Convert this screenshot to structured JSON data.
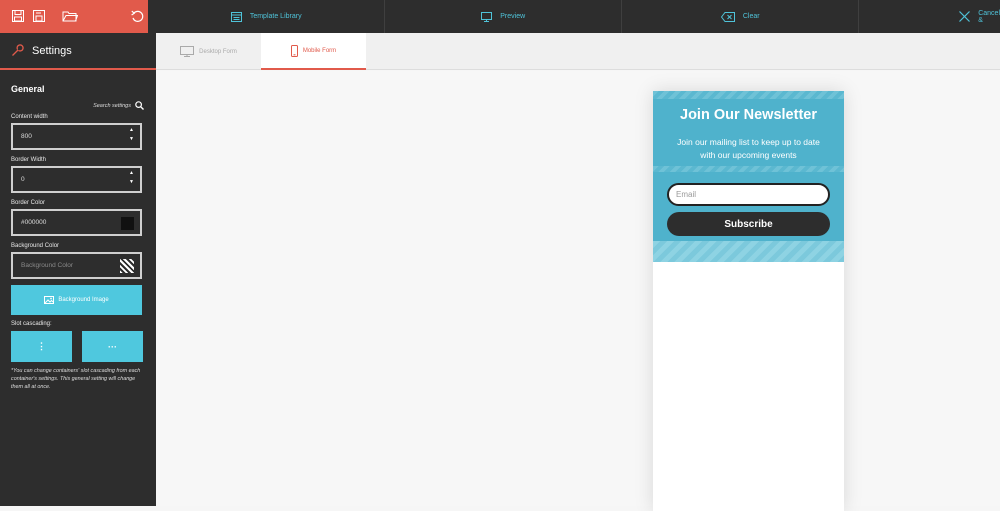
{
  "topbar": {
    "icons": [
      "save-icon",
      "save-as-icon",
      "open-folder-icon",
      "undo-icon"
    ],
    "nav": [
      {
        "label": "Template Library",
        "icon": "template-library-icon"
      },
      {
        "label": "Preview",
        "icon": "monitor-icon"
      },
      {
        "label": "Clear",
        "icon": "clear-icon"
      },
      {
        "label": "Cancel &",
        "icon": "close-icon"
      }
    ],
    "accent": "#e15a4b",
    "link_color": "#4fc3d9"
  },
  "sidebar": {
    "title": "Settings",
    "section": "General",
    "search_label": "Search settings",
    "content_width_label": "Content width",
    "content_width_value": "800",
    "border_width_label": "Border Width",
    "border_width_value": "0",
    "border_color_label": "Border Color",
    "border_color_value": "#000000",
    "background_color_label": "Background Color",
    "background_color_placeholder": "Background Color",
    "background_image_label": "Background Image",
    "slot_cascading_label": "Slot cascading:",
    "cascade_vertical": "⋮",
    "cascade_horizontal": "···",
    "note": "*You can change containers' slot cascading from each container's settings. This general setting will change them all at once."
  },
  "tabs": [
    {
      "label": "Desktop Form",
      "icon": "desktop-icon",
      "active": false
    },
    {
      "label": "Mobile Form",
      "icon": "mobile-icon",
      "active": true
    }
  ],
  "form": {
    "heading": "Join Our Newsletter",
    "subtext": "Join our mailing list to keep up to date with our upcoming events",
    "email_placeholder": "Email",
    "button_label": "Subscribe",
    "bg_color": "#4fb2cc"
  }
}
